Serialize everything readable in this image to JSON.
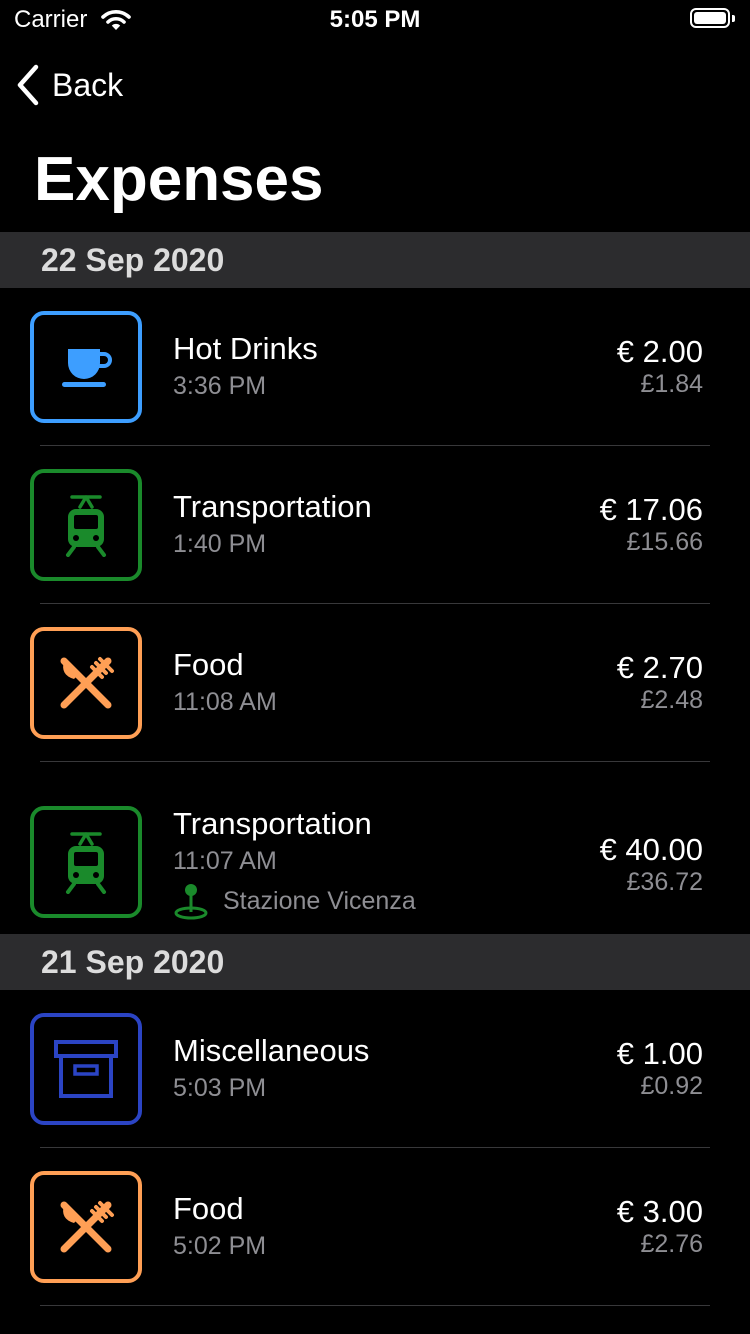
{
  "status_bar": {
    "carrier": "Carrier",
    "time": "5:05 PM"
  },
  "nav": {
    "back_label": "Back",
    "title": "Expenses"
  },
  "colors": {
    "hot_drinks": "#3d9eff",
    "transportation": "#1a8a2b",
    "food": "#ff9f55",
    "miscellaneous": "#2b44c4"
  },
  "sections": [
    {
      "date": "22 Sep 2020",
      "items": [
        {
          "category": "Hot Drinks",
          "icon": "cup-icon",
          "time": "3:36 PM",
          "amount": "€ 2.00",
          "converted": "£1.84"
        },
        {
          "category": "Transportation",
          "icon": "train-icon",
          "time": "1:40 PM",
          "amount": "€ 17.06",
          "converted": "£15.66"
        },
        {
          "category": "Food",
          "icon": "fork-knife-icon",
          "time": "11:08 AM",
          "amount": "€ 2.70",
          "converted": "£2.48"
        },
        {
          "category": "Transportation",
          "icon": "train-icon",
          "time": "11:07 AM",
          "location": "Stazione Vicenza",
          "amount": "€ 40.00",
          "converted": "£36.72"
        }
      ]
    },
    {
      "date": "21 Sep 2020",
      "items": [
        {
          "category": "Miscellaneous",
          "icon": "box-icon",
          "time": "5:03 PM",
          "amount": "€ 1.00",
          "converted": "£0.92"
        },
        {
          "category": "Food",
          "icon": "fork-knife-icon",
          "time": "5:02 PM",
          "amount": "€ 3.00",
          "converted": "£2.76"
        }
      ]
    }
  ]
}
